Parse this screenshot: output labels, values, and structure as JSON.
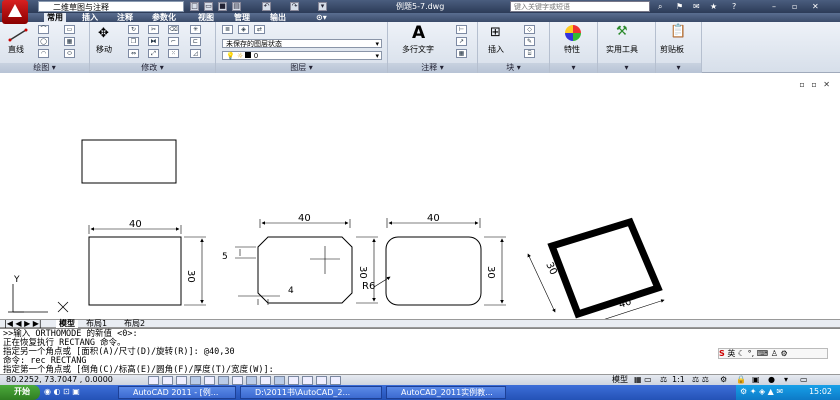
{
  "titlebar": {
    "workspace": "二维草图与注释",
    "document": "例题5-7.dwg",
    "search_placeholder": "键入关键字或短语"
  },
  "menu": {
    "items": [
      "常用",
      "插入",
      "注释",
      "参数化",
      "视图",
      "管理",
      "输出"
    ]
  },
  "ribbon": {
    "draw": {
      "label": "绘图",
      "line": "直线"
    },
    "modify": {
      "label": "修改",
      "move": "移动"
    },
    "layer": {
      "label": "图层",
      "state": "未保存的图层状态",
      "current": "0"
    },
    "annotate": {
      "label": "注释",
      "mtext": "多行文字",
      "big": "A"
    },
    "block": {
      "label": "块",
      "insert": "插入"
    },
    "properties": {
      "label": "特性"
    },
    "utilities": {
      "label": "实用工具"
    },
    "clipboard": {
      "label": "剪贴板"
    }
  },
  "drawing": {
    "dims": {
      "a_width": "40",
      "a_height": "30",
      "b_width": "40",
      "b_height": "30",
      "b_chamfer_v": "5",
      "b_chamfer_h": "4",
      "c_width": "40",
      "c_height": "30",
      "c_fillet": "R6",
      "d_width": "40",
      "d_height": "30"
    },
    "ucs_y": "Y"
  },
  "tabs": [
    "模型",
    "布局1",
    "布局2"
  ],
  "command": {
    "lines": [
      ">>输入 ORTHOMODE 的新值 <0>:",
      "正在恢复执行 RECTANG 命令。",
      "指定另一个角点或 [面积(A)/尺寸(D)/旋转(R)]: @40,30",
      "命令: rec RECTANG",
      "指定第一个角点或 [倒角(C)/标高(E)/圆角(F)/厚度(T)/宽度(W)]:"
    ]
  },
  "ime": {
    "label": "英"
  },
  "status": {
    "coords": "80.2252,  73.7047 , 0.0000",
    "model": "模型",
    "scale": "1:1"
  },
  "taskbar": {
    "start": "开始",
    "items": [
      "AutoCAD 2011 - [例...",
      "D:\\2011书\\AutoCAD_2...",
      "AutoCAD_2011实例教..."
    ],
    "clock": "15:02"
  },
  "colors": {
    "titlebar": "#2c3b57",
    "ribbon": "#dfe5ef",
    "taskbar": "#2452b6",
    "accent": "#c00000"
  }
}
